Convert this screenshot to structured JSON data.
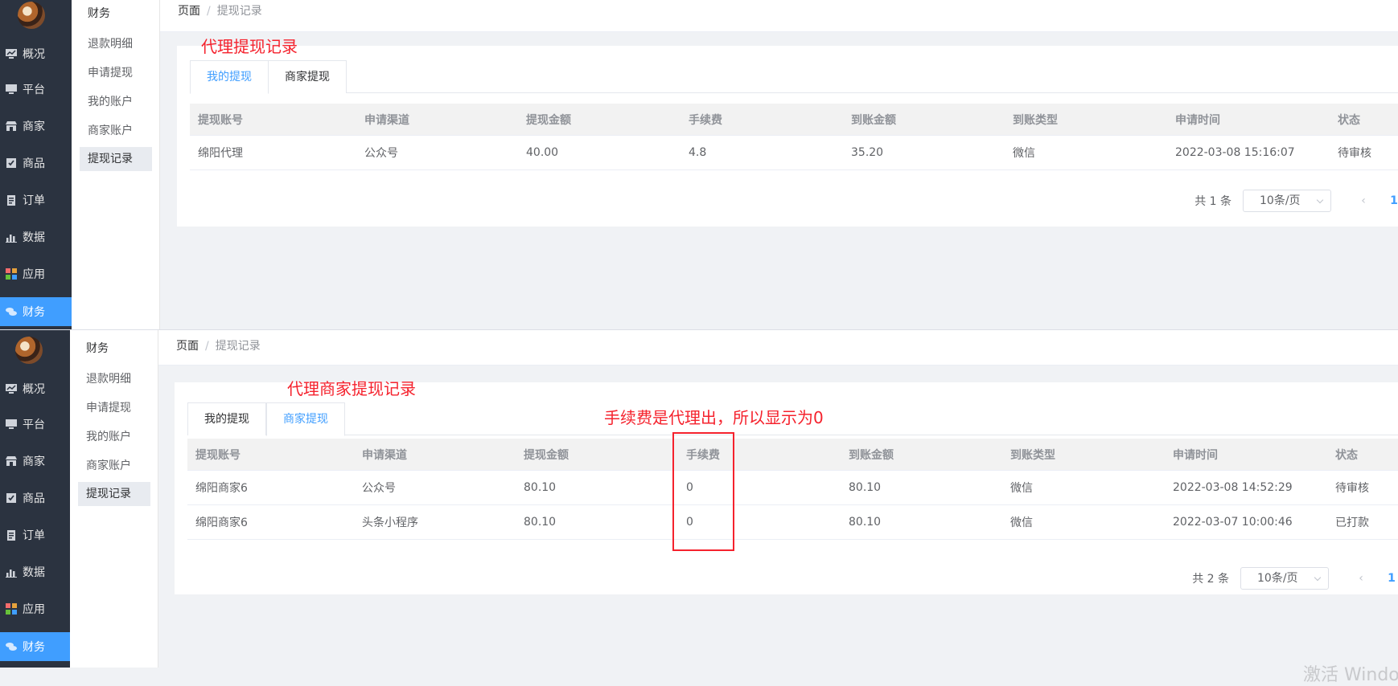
{
  "nav": {
    "items": [
      {
        "label": "概况",
        "icon": "monitor-chart-icon"
      },
      {
        "label": "平台",
        "icon": "desktop-icon"
      },
      {
        "label": "商家",
        "icon": "store-icon"
      },
      {
        "label": "商品",
        "icon": "box-check-icon"
      },
      {
        "label": "订单",
        "icon": "clipboard-icon"
      },
      {
        "label": "数据",
        "icon": "bar-chart-icon"
      },
      {
        "label": "应用",
        "icon": "grid-apps-icon"
      },
      {
        "label": "财务",
        "icon": "coins-icon"
      }
    ],
    "active": "财务"
  },
  "submenu": {
    "heading": "财务",
    "items": [
      "退款明细",
      "申请提现",
      "我的账户",
      "商家账户",
      "提现记录"
    ],
    "active": "提现记录"
  },
  "breadcrumb": {
    "root": "页面",
    "separator": "/",
    "current": "提现记录"
  },
  "columns": [
    "提现账号",
    "申请渠道",
    "提现金额",
    "手续费",
    "到账金额",
    "到账类型",
    "申请时间",
    "状态"
  ],
  "panel_top": {
    "annotation": "代理提现记录",
    "tabs": [
      "我的提现",
      "商家提现"
    ],
    "active_tab": 0,
    "rows": [
      [
        "绵阳代理",
        "公众号",
        "40.00",
        "4.8",
        "35.20",
        "微信",
        "2022-03-08 15:16:07",
        "待审核"
      ]
    ],
    "pager": {
      "total": "共 1 条",
      "size": "10条/页",
      "prev": "‹",
      "page": "1",
      "next": "›"
    }
  },
  "panel_bottom": {
    "annotation": "代理商家提现记录",
    "note": "手续费是代理出，所以显示为0",
    "tabs": [
      "我的提现",
      "商家提现"
    ],
    "active_tab": 1,
    "rows": [
      [
        "绵阳商家6",
        "公众号",
        "80.10",
        "0",
        "80.10",
        "微信",
        "2022-03-08 14:52:29",
        "待审核"
      ],
      [
        "绵阳商家6",
        "头条小程序",
        "80.10",
        "0",
        "80.10",
        "微信",
        "2022-03-07 10:00:46",
        "已打款"
      ]
    ],
    "pager": {
      "total": "共 2 条",
      "size": "10条/页",
      "prev": "‹",
      "page": "1",
      "next": "›"
    }
  },
  "watermark": "激活 Windows",
  "colors": {
    "accent": "#409eff",
    "sidebar": "#2b3340",
    "annotation_red": "#f5222d"
  }
}
